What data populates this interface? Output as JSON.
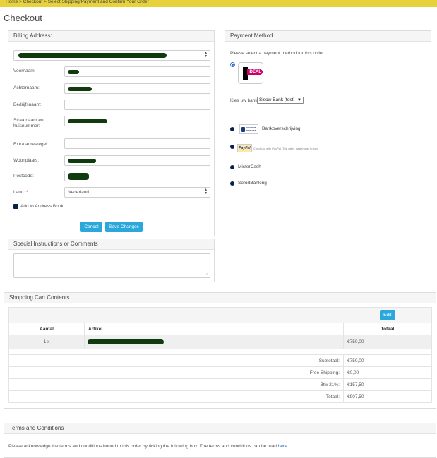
{
  "breadcrumb": "Home > Checkout > Select Shipping/Payment and Confirm Your Order",
  "page_title": "Checkout",
  "billing": {
    "title": "Billing Address:",
    "fields": {
      "voornaam": "Voornaam:",
      "achternaam": "Achternaam:",
      "bedrijfsnaam": "Bedrijfsnaam:",
      "straatnaam": "Straatnaam en huisnummer:",
      "extra": "Extra adresregel:",
      "woonplaats": "Woonplaats:",
      "postcode": "Postcode:",
      "land": "Land:",
      "land_required": "*"
    },
    "land_value": "Nederland",
    "add_to_book": "Add to Address Book",
    "cancel": "Cancel",
    "save": "Save Changes"
  },
  "instructions": {
    "title": "Special Instructions or Comments"
  },
  "payment": {
    "title": "Payment Method",
    "intro": "Please select a payment method for this order.",
    "ideal_logo": "iDEAL",
    "bank_label": "Kies uw bank",
    "bank_value": "Sisow Bank (test)",
    "voorruit_logo": "VOORUIT BETALEN",
    "bankoverschrijving": "Bankoverschrijving",
    "paypal_logo": "PayPal",
    "paypal_text": "Checkout with PayPal. The safer, easier way to pay.",
    "mistercash": "MisterCash",
    "sofort": "SofortBanking"
  },
  "cart": {
    "title": "Shopping Cart Contents",
    "edit": "Edit",
    "col_aantal": "Aantal",
    "col_artikel": "Artikel",
    "col_totaal": "Totaal",
    "row_qty": "1 x",
    "row_price": "€750,00",
    "subtotal_label": "Subtotaal:",
    "subtotal": "€750,00",
    "shipping_label": "Free Shipping:",
    "shipping": "€0,00",
    "btw_label": "Btw 21%:",
    "btw": "€157,50",
    "total_label": "Totaal:",
    "total": "€907,50"
  },
  "terms": {
    "title": "Terms and Conditions",
    "text": "Please acknowledge the terms and conditions bound to this order by ticking the following box. The terms and conditions can be read",
    "link": "here."
  }
}
